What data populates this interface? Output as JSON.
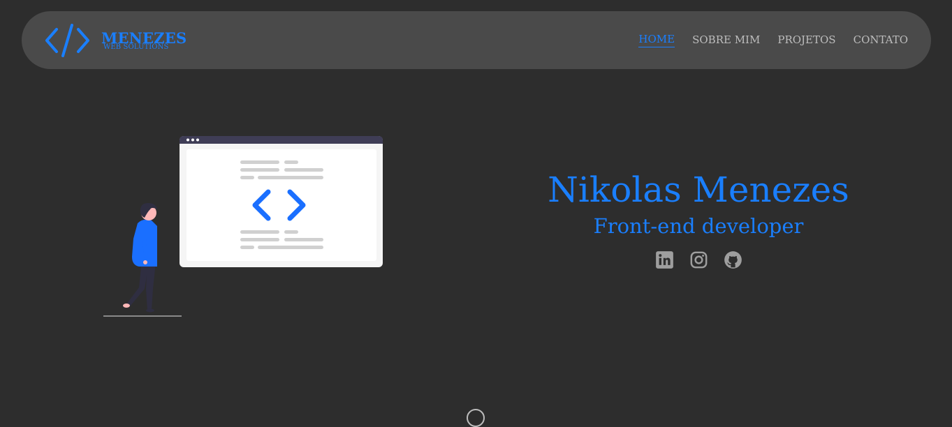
{
  "brand": {
    "title": "MENEZES",
    "subtitle": "WEB SOLUTIONS",
    "icon": "code-brackets-icon",
    "color": "#1a7fff"
  },
  "nav": {
    "items": [
      {
        "label": "HOME",
        "active": true
      },
      {
        "label": "SOBRE MIM",
        "active": false
      },
      {
        "label": "PROJETOS",
        "active": false
      },
      {
        "label": "CONTATO",
        "active": false
      }
    ]
  },
  "hero": {
    "name": "Nikolas Menezes",
    "role": "Front-end developer",
    "socials": [
      {
        "icon": "linkedin-icon"
      },
      {
        "icon": "instagram-icon"
      },
      {
        "icon": "github-icon"
      }
    ]
  },
  "colors": {
    "background": "#2d2d2d",
    "navbar": "#4a4a4a",
    "accent": "#1a7fff",
    "nav_text": "#bdbdbd"
  }
}
